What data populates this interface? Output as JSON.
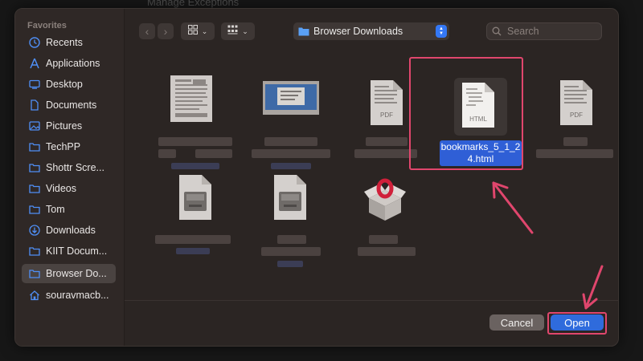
{
  "background": {
    "partial_text": "Manage Exceptions"
  },
  "sidebar": {
    "header": "Favorites",
    "items": [
      {
        "label": "Recents",
        "icon": "clock-icon"
      },
      {
        "label": "Applications",
        "icon": "applications-icon"
      },
      {
        "label": "Desktop",
        "icon": "desktop-icon"
      },
      {
        "label": "Documents",
        "icon": "document-icon"
      },
      {
        "label": "Pictures",
        "icon": "pictures-icon"
      },
      {
        "label": "TechPP",
        "icon": "folder-icon"
      },
      {
        "label": "Shottr Scre...",
        "icon": "folder-icon"
      },
      {
        "label": "Videos",
        "icon": "folder-icon"
      },
      {
        "label": "Tom",
        "icon": "folder-icon"
      },
      {
        "label": "Downloads",
        "icon": "downloads-icon"
      },
      {
        "label": "KIIT Docum...",
        "icon": "folder-icon"
      },
      {
        "label": "Browser Do...",
        "icon": "folder-icon",
        "selected": true
      },
      {
        "label": "souravmacb...",
        "icon": "home-icon"
      }
    ]
  },
  "toolbar": {
    "current_folder": "Browser Downloads",
    "search_placeholder": "Search"
  },
  "files": {
    "selected_name_line1": "bookmarks_5_1_2",
    "selected_name_line2": "4.html",
    "html_label": "HTML",
    "pdf_label": "PDF"
  },
  "buttons": {
    "cancel": "Cancel",
    "open": "Open"
  },
  "colors": {
    "accent": "#2f6bdc",
    "annotation": "#e0466d",
    "dialog_bg": "#2b2523"
  }
}
